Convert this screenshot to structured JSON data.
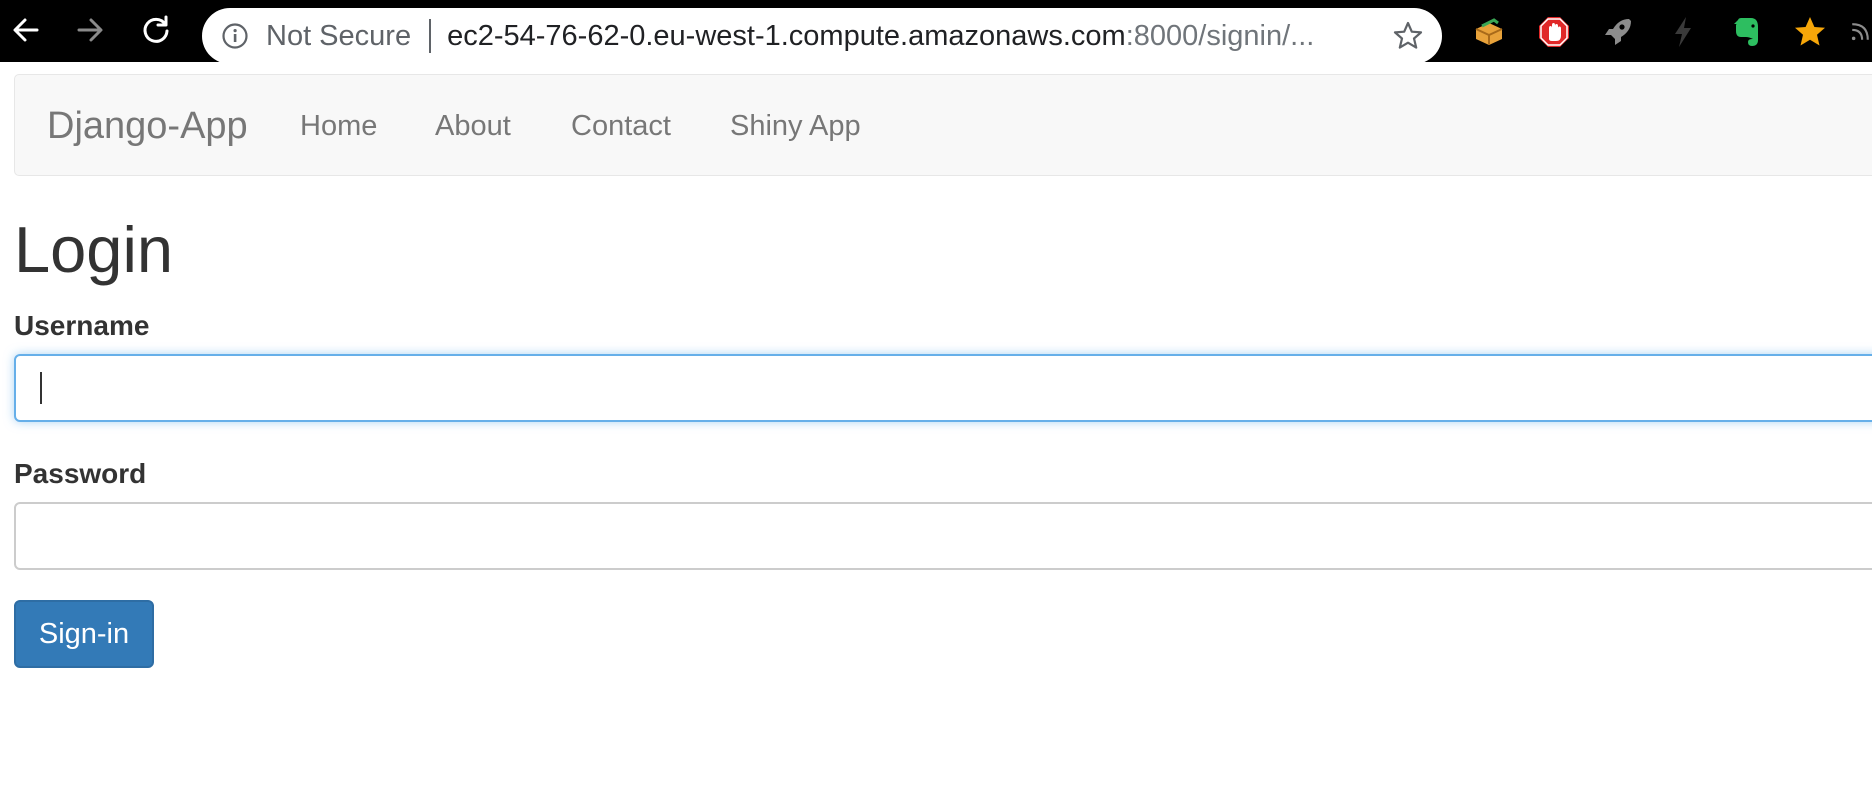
{
  "browser": {
    "security_label": "Not Secure",
    "url_host": "ec2-54-76-62-0.eu-west-1.compute.amazonaws.com",
    "url_path": ":8000/signin/...",
    "extensions": [
      "package-icon",
      "adblock-icon",
      "rocket-icon",
      "lightning-icon",
      "evernote-icon",
      "favorite-star-icon",
      "rss-icon"
    ]
  },
  "navbar": {
    "brand": "Django-App",
    "links": [
      "Home",
      "About",
      "Contact",
      "Shiny App"
    ],
    "background": "#f8f8f8",
    "link_color": "#777777"
  },
  "page": {
    "title": "Login",
    "username_label": "Username",
    "username_value": "",
    "password_label": "Password",
    "password_value": "",
    "submit_label": "Sign-in",
    "accent": "#337ab7",
    "focus_color": "#66afe9"
  }
}
